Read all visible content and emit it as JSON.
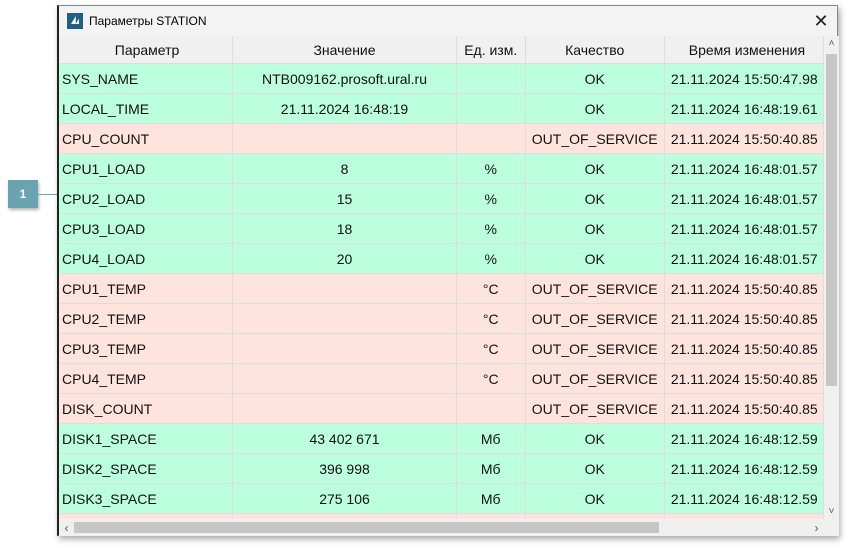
{
  "window": {
    "title": "Параметры STATION",
    "close_icon": "close-icon"
  },
  "colors": {
    "ok_row": "#bcffdf",
    "bad_row": "#ffe4de",
    "callout": "#6aa4b0"
  },
  "columns": [
    "Параметр",
    "Значение",
    "Ед. изм.",
    "Качество",
    "Время изменения"
  ],
  "rows": [
    {
      "p": "SYS_NAME",
      "v": "NTB009162.prosoft.ural.ru",
      "u": "",
      "q": "OK",
      "t": "21.11.2024 15:50:47.98"
    },
    {
      "p": "LOCAL_TIME",
      "v": "21.11.2024 16:48:19",
      "u": "",
      "q": "OK",
      "t": "21.11.2024 16:48:19.61"
    },
    {
      "p": "CPU_COUNT",
      "v": "",
      "u": "",
      "q": "OUT_OF_SERVICE",
      "t": "21.11.2024 15:50:40.85"
    },
    {
      "p": "CPU1_LOAD",
      "v": "8",
      "u": "%",
      "q": "OK",
      "t": "21.11.2024 16:48:01.57"
    },
    {
      "p": "CPU2_LOAD",
      "v": "15",
      "u": "%",
      "q": "OK",
      "t": "21.11.2024 16:48:01.57"
    },
    {
      "p": "CPU3_LOAD",
      "v": "18",
      "u": "%",
      "q": "OK",
      "t": "21.11.2024 16:48:01.57"
    },
    {
      "p": "CPU4_LOAD",
      "v": "20",
      "u": "%",
      "q": "OK",
      "t": "21.11.2024 16:48:01.57"
    },
    {
      "p": "CPU1_TEMP",
      "v": "",
      "u": "°C",
      "q": "OUT_OF_SERVICE",
      "t": "21.11.2024 15:50:40.85"
    },
    {
      "p": "CPU2_TEMP",
      "v": "",
      "u": "°C",
      "q": "OUT_OF_SERVICE",
      "t": "21.11.2024 15:50:40.85"
    },
    {
      "p": "CPU3_TEMP",
      "v": "",
      "u": "°C",
      "q": "OUT_OF_SERVICE",
      "t": "21.11.2024 15:50:40.85"
    },
    {
      "p": "CPU4_TEMP",
      "v": "",
      "u": "°C",
      "q": "OUT_OF_SERVICE",
      "t": "21.11.2024 15:50:40.85"
    },
    {
      "p": "DISK_COUNT",
      "v": "",
      "u": "",
      "q": "OUT_OF_SERVICE",
      "t": "21.11.2024 15:50:40.85"
    },
    {
      "p": "DISK1_SPACE",
      "v": "43 402 671",
      "u": "Мб",
      "q": "OK",
      "t": "21.11.2024 16:48:12.59"
    },
    {
      "p": "DISK2_SPACE",
      "v": "396 998",
      "u": "Мб",
      "q": "OK",
      "t": "21.11.2024 16:48:12.59"
    },
    {
      "p": "DISK3_SPACE",
      "v": "275 106",
      "u": "Мб",
      "q": "OK",
      "t": "21.11.2024 16:48:12.59"
    },
    {
      "p": "",
      "v": "",
      "u": "",
      "q": "",
      "t": ""
    }
  ],
  "row_status": [
    "ok",
    "ok",
    "bad",
    "ok",
    "ok",
    "ok",
    "ok",
    "bad",
    "bad",
    "bad",
    "bad",
    "bad",
    "ok",
    "ok",
    "ok",
    "bad"
  ],
  "callout": {
    "label": "1"
  }
}
